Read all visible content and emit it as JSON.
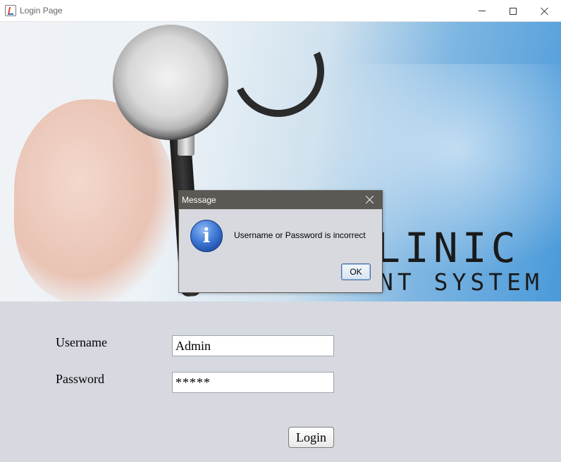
{
  "window": {
    "title": "Login Page",
    "icon": "java-app-icon",
    "controls": [
      "minimize",
      "maximize",
      "close"
    ]
  },
  "banner": {
    "line1": "LINIC",
    "line2": "NT  SYSTEM"
  },
  "form": {
    "username_label": "Username",
    "password_label": "Password",
    "username_value": "Admin",
    "password_value": "*****",
    "login_label": "Login"
  },
  "dialog": {
    "title": "Message",
    "icon": "information-icon",
    "message": "Username or Password is incorrect",
    "ok_label": "OK"
  },
  "colors": {
    "form_background": "#d6d9e0",
    "dialog_titlebar": "#5c5955",
    "info_icon": "#3e7ad6"
  }
}
